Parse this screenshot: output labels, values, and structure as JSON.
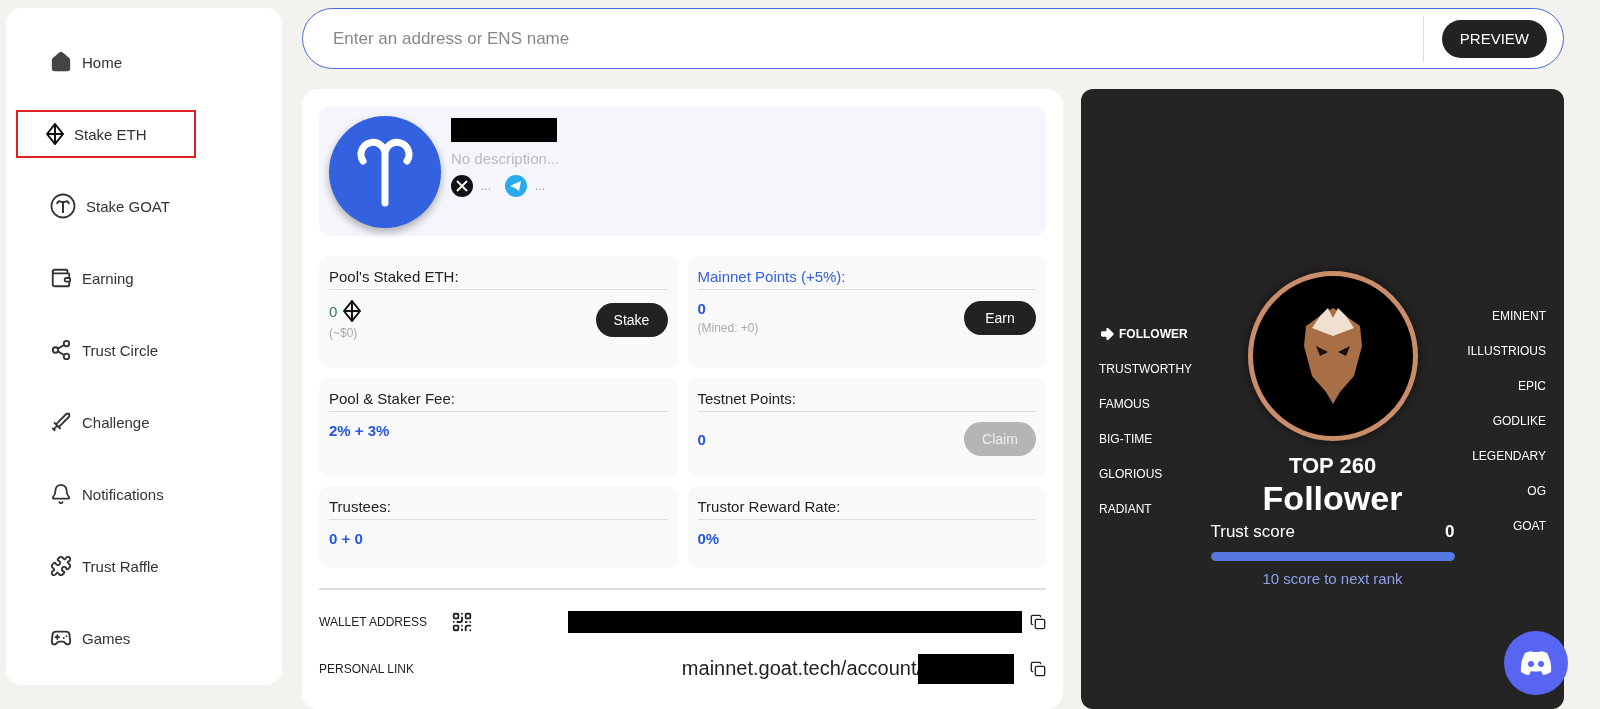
{
  "sidebar": {
    "items": [
      {
        "label": "Home",
        "selected": false
      },
      {
        "label": "Stake ETH",
        "selected": true
      },
      {
        "label": "Stake GOAT",
        "selected": false
      },
      {
        "label": "Earning",
        "selected": false
      },
      {
        "label": "Trust Circle",
        "selected": false
      },
      {
        "label": "Challenge",
        "selected": false
      },
      {
        "label": "Notifications",
        "selected": false
      },
      {
        "label": "Trust Raffle",
        "selected": false
      },
      {
        "label": "Games",
        "selected": false
      }
    ]
  },
  "search": {
    "placeholder": "Enter an address or ENS name",
    "button": "PREVIEW"
  },
  "profile": {
    "description": "No description...",
    "socials": [
      "...",
      "..."
    ]
  },
  "stats": [
    {
      "label": "Pool's Staked ETH:",
      "label_link": false,
      "value": "0",
      "kind": "eth",
      "sub": "(~$0)",
      "button": {
        "label": "Stake",
        "disabled": false
      }
    },
    {
      "label": "Mainnet Points (+5%):",
      "label_link": true,
      "value": "0",
      "kind": "plain",
      "sub": "(Mined: +0)",
      "button": {
        "label": "Earn",
        "disabled": false
      }
    },
    {
      "label": "Pool & Staker Fee:",
      "label_link": false,
      "value": "2% + 3%",
      "kind": "plain"
    },
    {
      "label": "Testnet Points:",
      "label_link": false,
      "value": "0",
      "kind": "plain",
      "button": {
        "label": "Claim",
        "disabled": true
      }
    },
    {
      "label": "Trustees:",
      "label_link": false,
      "value": "0 + 0",
      "kind": "plain"
    },
    {
      "label": "Trustor Reward Rate:",
      "label_link": false,
      "value": "0%",
      "kind": "plain"
    }
  ],
  "wallet": {
    "address_label": "WALLET ADDRESS",
    "link_label": "PERSONAL LINK",
    "link": "mainnet.goat.tech/account/"
  },
  "rank": {
    "left": [
      {
        "label": "FOLLOWER",
        "selected": true
      },
      {
        "label": "TRUSTWORTHY",
        "selected": false
      },
      {
        "label": "FAMOUS",
        "selected": false
      },
      {
        "label": "BIG-TIME",
        "selected": false
      },
      {
        "label": "GLORIOUS",
        "selected": false
      },
      {
        "label": "RADIANT",
        "selected": false
      }
    ],
    "right": [
      {
        "label": "EMINENT",
        "selected": false
      },
      {
        "label": "ILLUSTRIOUS",
        "selected": false
      },
      {
        "label": "EPIC",
        "selected": false
      },
      {
        "label": "GODLIKE",
        "selected": false
      },
      {
        "label": "LEGENDARY",
        "selected": false
      },
      {
        "label": "OG",
        "selected": false
      },
      {
        "label": "GOAT",
        "selected": false
      }
    ],
    "top": "TOP 260",
    "title": "Follower",
    "score_label": "Trust score",
    "score": "0",
    "level": 1,
    "hint": "10 score to next rank"
  }
}
